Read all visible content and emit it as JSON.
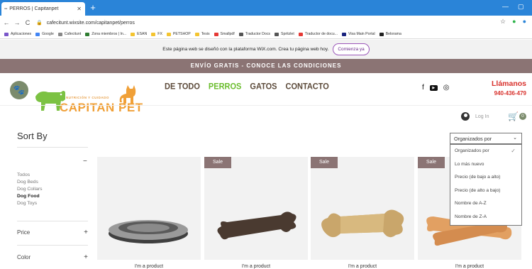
{
  "browser": {
    "tab_title": "PERROS | Capitanpet",
    "tab_favicon": "wix-favicon",
    "url": "cafecitunt.wixsite.com/capitanpet/perros",
    "bookmarks": [
      {
        "label": "Aplicaciones",
        "color": "#7a57c9"
      },
      {
        "label": "Google",
        "color": "#4285f4"
      },
      {
        "label": "Cafecitunt",
        "color": "#888888"
      },
      {
        "label": "Zona miembros | In...",
        "color": "#2f7d32"
      },
      {
        "label": "ESAN",
        "color": "#f4c430"
      },
      {
        "label": "FX",
        "color": "#f4c430"
      },
      {
        "label": "PETSHOP",
        "color": "#f4c430"
      },
      {
        "label": "Tesis",
        "color": "#f4c430"
      },
      {
        "label": "Smallpdf",
        "color": "#e53935"
      },
      {
        "label": "Traductor Docs",
        "color": "#555555"
      },
      {
        "label": "Spritzlet",
        "color": "#555555"
      },
      {
        "label": "Traductor de docu...",
        "color": "#e53935"
      },
      {
        "label": "Visa Main Portal",
        "color": "#1a237e"
      },
      {
        "label": "Belorama",
        "color": "#222222"
      }
    ]
  },
  "wix_banner": {
    "text": "Este página web se diseñó con la plataforma WiX.com. Crea tu página web hoy.",
    "cta": "Comienza ya"
  },
  "shipping_bar": "ENVÍO GRATIS - CONOCE LAS CONDICIONES",
  "logo": {
    "subtitle": "NUTRICIÓN Y CUIDADO",
    "name": "CAPITAN PET"
  },
  "nav": [
    "DE TODO",
    "PERROS",
    "GATOS",
    "CONTACTO"
  ],
  "nav_active": "PERROS",
  "contact": {
    "title": "Llámanos",
    "phone": "940-436-479"
  },
  "account": {
    "login": "Log In",
    "cart_count": "0"
  },
  "filters": {
    "sort_title": "Sort By",
    "categories": [
      "Todos",
      "Dog Beds",
      "Dog Collars",
      "Dog Food",
      "Dog Toys"
    ],
    "selected_category": "Dog Food",
    "facets": [
      "Price",
      "Color"
    ]
  },
  "sort": {
    "selected": "Organizados por",
    "options": [
      "Organizados por",
      "Lo más nuevo",
      "Precio (de bajo a alto)",
      "Precio (de alto a bajo)",
      "Nombre de A-Z",
      "Nombre de Z-A"
    ]
  },
  "products": [
    {
      "name": "I'm a product",
      "sale": "",
      "image": "steel-bowl"
    },
    {
      "name": "I'm a product",
      "sale": "Sale",
      "image": "bone-chew"
    },
    {
      "name": "I'm a product",
      "sale": "Sale",
      "image": "rawhide-knot"
    },
    {
      "name": "I'm a product",
      "sale": "Sale",
      "image": "rawhide-bones"
    }
  ],
  "colors": {
    "accent": "#8b7474",
    "nav_active": "#6bbd2e",
    "phone": "#d8312c",
    "logo": "#f0a038"
  }
}
